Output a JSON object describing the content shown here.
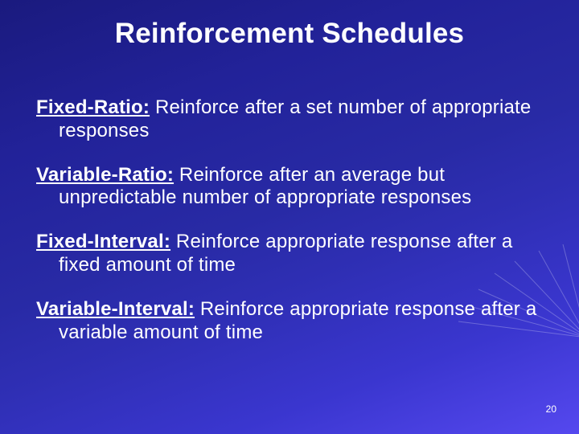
{
  "title": "Reinforcement  Schedules",
  "items": [
    {
      "term": "Fixed-Ratio:",
      "text": " Reinforce after a set number of appropriate responses"
    },
    {
      "term": "Variable-Ratio:",
      "text": " Reinforce after an average but unpredictable number of appropriate responses"
    },
    {
      "term": "Fixed-Interval:",
      "text": " Reinforce appropriate response after a fixed amount of time"
    },
    {
      "term": "Variable-Interval:",
      "text": " Reinforce appropriate response after a variable amount of time"
    }
  ],
  "page_number": "20"
}
